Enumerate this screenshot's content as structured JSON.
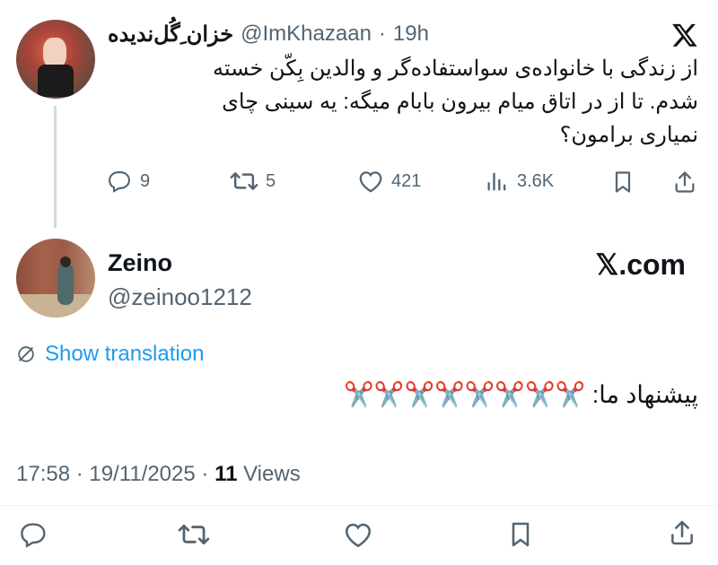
{
  "quoted_tweet": {
    "display_name": "خزان ِگُل‌ندیده",
    "handle": "@ImKhazaan",
    "separator": "·",
    "time": "19h",
    "text_line1": "از زندگی با خانواده‌ی سواستفاده‌گر و والدین بِکّن خسته",
    "text_line2": "شدم. تا از در اتاق میام بیرون بابام میگه: یه سینی چای",
    "text_line3": "نمیاری برامون؟",
    "actions": {
      "replies": "9",
      "reposts": "5",
      "likes": "421",
      "views": "3.6K"
    },
    "platform_icon": "x-logo-icon"
  },
  "reply_tweet": {
    "display_name": "Zeino",
    "handle": "@zeinoo1212",
    "brand_label": "𝕏.com",
    "show_translation": "Show translation",
    "text": "پیشنهاد ما: ✂️✂️✂️✂️✂️✂️✂️✂️",
    "timestamp": "17:58 · 19/11/2025 · ",
    "views_count": "11",
    "views_label": " Views"
  },
  "bottom_bar": {
    "icons": [
      "reply-icon",
      "repost-icon",
      "like-icon",
      "bookmark-icon",
      "share-icon"
    ]
  },
  "colors": {
    "text": "#0f1419",
    "muted": "#536471",
    "link": "#1d9bf0",
    "thread_line": "#cfd9de"
  }
}
